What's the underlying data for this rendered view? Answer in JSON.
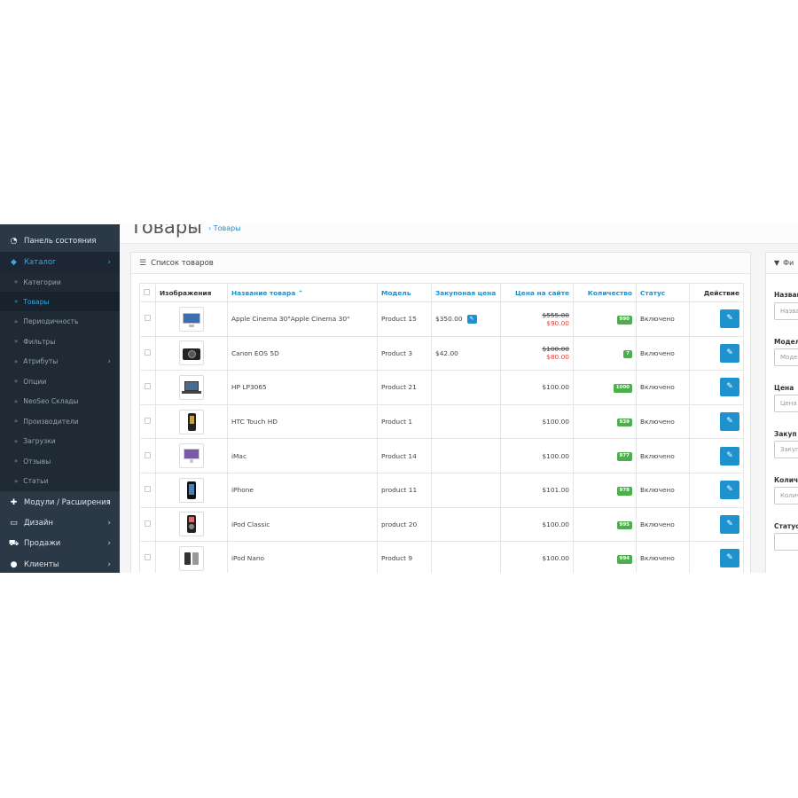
{
  "header": {
    "title": "Товары",
    "breadcrumb": "Товары"
  },
  "sidebar": {
    "items": [
      {
        "label": "Панель состояния",
        "icon": "dashboard-icon"
      },
      {
        "label": "Каталог",
        "icon": "tags-icon",
        "active": true
      },
      {
        "label": "Модули / Расширения",
        "icon": "puzzle-icon"
      },
      {
        "label": "Дизайн",
        "icon": "monitor-icon"
      },
      {
        "label": "Продажи",
        "icon": "cart-icon"
      },
      {
        "label": "Клиенты",
        "icon": "user-icon"
      }
    ],
    "submenu": [
      {
        "label": "Категории"
      },
      {
        "label": "Товары",
        "active": true
      },
      {
        "label": "Периодичность"
      },
      {
        "label": "Фильтры"
      },
      {
        "label": "Атрибуты",
        "has_children": true
      },
      {
        "label": "Опции"
      },
      {
        "label": "NeoSeo Склады"
      },
      {
        "label": "Производители"
      },
      {
        "label": "Загрузки"
      },
      {
        "label": "Отзывы"
      },
      {
        "label": "Статьи"
      }
    ]
  },
  "list": {
    "title": "Список товаров",
    "columns": {
      "image": "Изображения",
      "name": "Название товара",
      "model": "Модель",
      "cost": "Закупоная цена",
      "price": "Цена на сайте",
      "quantity": "Количество",
      "status": "Статус",
      "action": "Действие"
    },
    "rows": [
      {
        "name": "Apple Cinema 30\"Apple Cinema 30\"",
        "model": "Product 15",
        "cost": "$350.00",
        "price_old": "$555.00",
        "price": "$90.00",
        "special": true,
        "quantity": "990",
        "status": "Включено",
        "image": "monitor-product-icon"
      },
      {
        "name": "Canon EOS 5D",
        "model": "Product 3",
        "cost": "$42.00",
        "price_old": "$100.00",
        "price": "$80.00",
        "special": true,
        "quantity": "7",
        "status": "Включено",
        "image": "camera-product-icon"
      },
      {
        "name": "HP LP3065",
        "model": "Product 21",
        "cost": "",
        "price": "$100.00",
        "special": false,
        "quantity": "1000",
        "status": "Включено",
        "image": "laptop-product-icon"
      },
      {
        "name": "HTC Touch HD",
        "model": "Product 1",
        "cost": "",
        "price": "$100.00",
        "special": false,
        "quantity": "939",
        "status": "Включено",
        "image": "phone-product-icon"
      },
      {
        "name": "iMac",
        "model": "Product 14",
        "cost": "",
        "price": "$100.00",
        "special": false,
        "quantity": "977",
        "status": "Включено",
        "image": "imac-product-icon"
      },
      {
        "name": "iPhone",
        "model": "product 11",
        "cost": "",
        "price": "$101.00",
        "special": false,
        "quantity": "978",
        "status": "Включено",
        "image": "iphone-product-icon"
      },
      {
        "name": "iPod Classic",
        "model": "product 20",
        "cost": "",
        "price": "$100.00",
        "special": false,
        "quantity": "995",
        "status": "Включено",
        "image": "ipod-classic-product-icon"
      },
      {
        "name": "iPod Nano",
        "model": "Product 9",
        "cost": "",
        "price": "$100.00",
        "special": false,
        "quantity": "994",
        "status": "Включено",
        "image": "ipod-nano-product-icon"
      }
    ]
  },
  "filter": {
    "title": "Фи",
    "fields": [
      {
        "label": "Назван",
        "placeholder": "Назва"
      },
      {
        "label": "Модел",
        "placeholder": "Моде"
      },
      {
        "label": "Цена",
        "placeholder": "Цена"
      },
      {
        "label": "Закуп",
        "placeholder": "Закуп"
      },
      {
        "label": "Количе",
        "placeholder": "Колич"
      },
      {
        "label": "Статус",
        "placeholder": ""
      }
    ]
  },
  "colors": {
    "sidebar_bg": "#2b3846",
    "accent": "#1e91cf",
    "qty_badge": "#4cae4c",
    "special_price": "#e4443a"
  }
}
